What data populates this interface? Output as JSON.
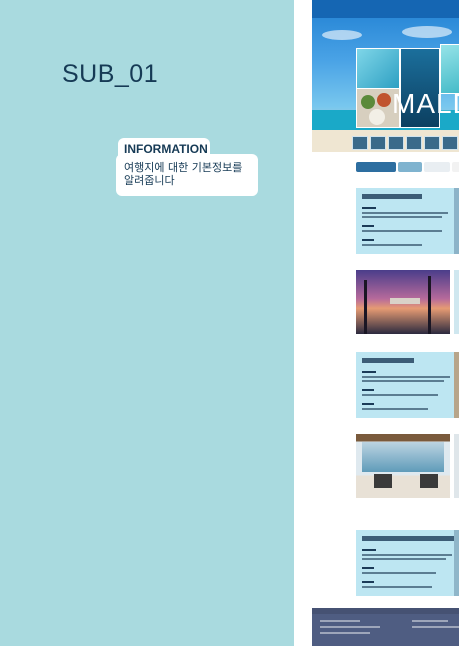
{
  "left": {
    "title": "SUB_01",
    "info_tab": "INFORMATION",
    "info_lines": [
      "여행지에 대한 기본정보를",
      "알려줍니다"
    ]
  },
  "hero": {
    "word": "MALDIVES"
  },
  "colors": {
    "left_bg": "#a9dadf",
    "card_bg": "#bde6f2",
    "footer_bg": "#4f5d82",
    "tab_accent": "#2d6ea0"
  }
}
